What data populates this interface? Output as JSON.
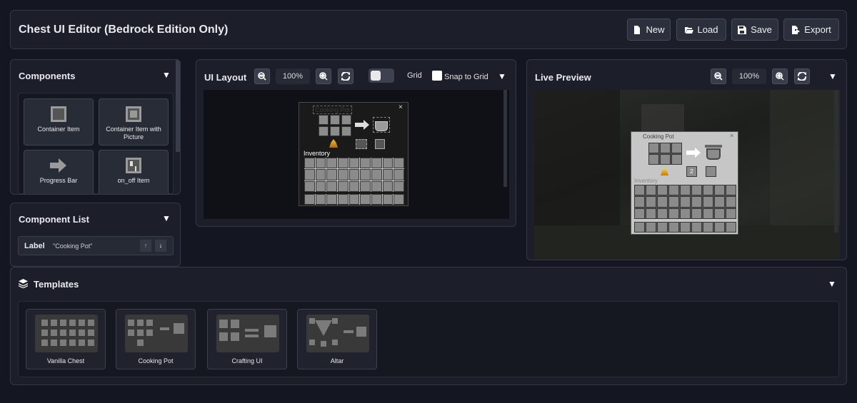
{
  "header": {
    "title": "Chest UI Editor (Bedrock Edition Only)",
    "buttons": {
      "new": "New",
      "load": "Load",
      "save": "Save",
      "export": "Export"
    }
  },
  "components_panel": {
    "title": "Components",
    "items": [
      {
        "label": "Container Item",
        "icon": "container-item-icon"
      },
      {
        "label": "Container Item with Picture",
        "icon": "picture-icon"
      },
      {
        "label": "Progress Bar",
        "icon": "arrow-right-icon"
      },
      {
        "label": "on_off Item",
        "icon": "toggle-item-icon"
      }
    ]
  },
  "component_list": {
    "title": "Component List",
    "rows": [
      {
        "type": "Label",
        "value": "\"Cooking Pot\""
      }
    ]
  },
  "ui_layout": {
    "title": "UI Layout",
    "zoom": "100%",
    "grid_label": "Grid",
    "snap_label": "Snap to Grid",
    "canvas_title": "Cooking Pot",
    "inventory_label": "Inventory",
    "close_symbol": "×"
  },
  "live_preview": {
    "title": "Live Preview",
    "zoom": "100%",
    "ui_title": "Cooking Pot",
    "inventory_label": "Inventory",
    "count": "2",
    "close_symbol": "×"
  },
  "templates": {
    "title": "Templates",
    "items": [
      {
        "label": "Vanilla Chest"
      },
      {
        "label": "Cooking Pot"
      },
      {
        "label": "Crafting UI"
      },
      {
        "label": "Altar"
      }
    ]
  },
  "colors": {
    "bg": "#141721",
    "panel": "#1c1f2a",
    "mc_panel": "#c6c6c6",
    "mc_slot": "#8b8b8b"
  }
}
